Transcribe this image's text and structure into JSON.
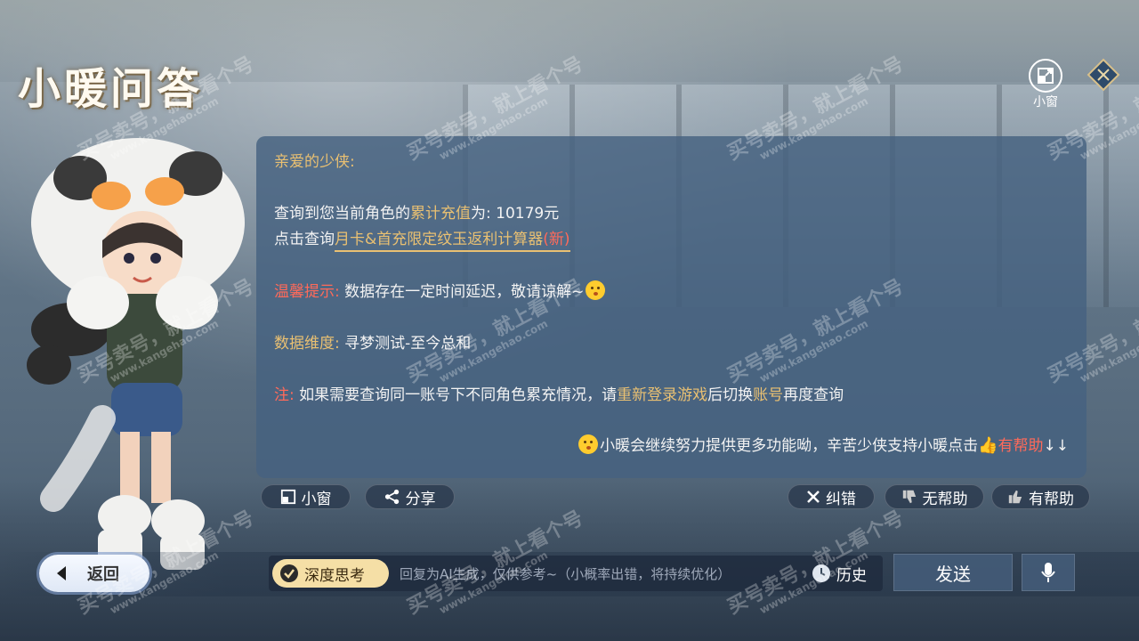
{
  "title": "小暖问答",
  "top_right": {
    "mini_window_label": "小窗"
  },
  "card": {
    "greeting": "亲爱的少侠:",
    "query_prefix": "查询到您当前角色的",
    "query_highlight": "累计充值",
    "query_suffix": "为: 10179元",
    "link_prefix": "点击查询",
    "link_text": "月卡&首充限定纹玉返利计算器",
    "link_new": "(新)",
    "tip_label": "温馨提示:",
    "tip_text": "数据存在一定时间延迟，敬请谅解~",
    "dimension_label": "数据维度:",
    "dimension_text": "寻梦测试-至今总和",
    "note_label": "注:",
    "note_text_1": "如果需要查询同一账号下不同角色累充情况，请",
    "note_highlight_1": "重新登录游戏",
    "note_text_2": "后切换",
    "note_highlight_2": "账号",
    "note_text_3": "再度查询",
    "footer_text": "小暖会继续努力提供更多功能呦，辛苦少侠支持小暖点击",
    "footer_helpful": "有帮助",
    "footer_arrows": "↓↓"
  },
  "actions": {
    "mini_window": "小窗",
    "share": "分享",
    "correct": "纠错",
    "not_helpful": "无帮助",
    "helpful": "有帮助"
  },
  "bottom": {
    "back": "返回",
    "deep_think": "深度思考",
    "placeholder": "回复为AI生成，仅供参考~（小概率出错，将持续优化）",
    "history": "历史",
    "send": "发送"
  },
  "watermark": {
    "line1": "买号卖号，就上看个号",
    "line2": "www.kangehao.com"
  },
  "colors": {
    "gold": "#e9c072",
    "red": "#ff6a5a",
    "card_bg": "#46628099"
  },
  "icons": [
    "mini-window-icon",
    "close-x-icon",
    "share-icon",
    "thumbs-down-icon",
    "thumbs-up-icon",
    "back-arrow-icon",
    "check-icon",
    "history-icon",
    "microphone-icon",
    "smile-emoji-icon"
  ]
}
